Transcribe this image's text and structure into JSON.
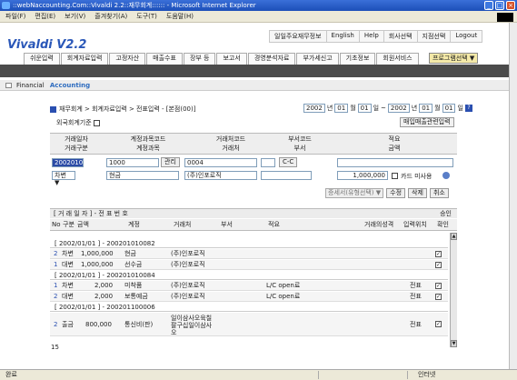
{
  "window": {
    "title": "::webNaccounting.Com::Vivaldi 2.2::재무회계:::::: - Microsoft Internet Explorer",
    "min": "_",
    "max": "□",
    "close": "×"
  },
  "menu": [
    "파일(F)",
    "편집(E)",
    "보기(V)",
    "즐겨찾기(A)",
    "도구(T)",
    "도움말(H)"
  ],
  "header": {
    "logo": "Vivaldi  V2.2",
    "top_links": [
      "일일주요재무정보",
      "English",
      "Help",
      "회사선택",
      "지점선택",
      "Logout"
    ],
    "nav": [
      "쉬운입력",
      "회계자료입력",
      "고정자산",
      "매출수표",
      "장부 등",
      "보고서",
      "경영분석자료",
      "부가세신고",
      "기초정보",
      "회원서비스"
    ],
    "program_select": "프로그램선택"
  },
  "section": {
    "financial": "Financial",
    "accounting": "Accounting"
  },
  "breadcrumb": "재무회계 > 회계자료입력 > 전표입력 - [본점(00)]",
  "date_range": {
    "from_year": "2002",
    "from_month": "01",
    "from_day": "01",
    "to_year": "2002",
    "to_month": "01",
    "to_day": "01",
    "year_label": "년",
    "month_label": "월",
    "day_label": "일",
    "tilde": "~",
    "help": "?"
  },
  "foreign_label": "외국회계기준",
  "related_button": "매입매출관련입력",
  "entry_headers": {
    "col1a": "거래일자",
    "col1b": "거래구분",
    "col2a": "계정과목코드",
    "col2b": "계정과목",
    "col3a": "거래처코드",
    "col3b": "거래처",
    "col4a": "부서코드",
    "col4b": "부서",
    "col5a": "적요",
    "col5b": "금액"
  },
  "entry": {
    "date": "20020101",
    "account_code": "1000",
    "lookup": "관리",
    "client_code": "0004",
    "dept_button": "C-C",
    "type": "차변",
    "account": "현금",
    "client": "(주)인포로직",
    "amount": "1,000,000",
    "card_label": "카드 미사용"
  },
  "actions": {
    "select": "증세서(유형선택)",
    "edit": "수정",
    "delete": "삭제",
    "cancel": "취소"
  },
  "list": {
    "title": "[ 거 래 일 자 ] - 전  표  번  호",
    "approve": "승인",
    "headers": [
      "No",
      "구분",
      "금액",
      "계정",
      "거래처",
      "부서",
      "적요",
      "거래의성격",
      "입력위치",
      "확인"
    ],
    "groups": [
      {
        "label": "[ 2002/01/01 ] - 200201010082",
        "rows": [
          {
            "no": "2",
            "type": "차변",
            "amount": "1,000,000",
            "account": "현금",
            "client": "(주)인포로직",
            "dept": "",
            "memo": "",
            "nature": "",
            "pos": "",
            "check": "✓"
          },
          {
            "no": "1",
            "type": "대변",
            "amount": "1,000,000",
            "account": "선수금",
            "client": "(주)인포로직",
            "dept": "",
            "memo": "",
            "nature": "",
            "pos": "",
            "check": "✓"
          }
        ]
      },
      {
        "label": "[ 2002/01/01 ] - 200201010084",
        "rows": [
          {
            "no": "1",
            "type": "차변",
            "amount": "2,000",
            "account": "미착품",
            "client": "(주)인포로직",
            "dept": "",
            "memo": "L/C open료",
            "nature": "",
            "pos": "전표",
            "check": "✓"
          },
          {
            "no": "2",
            "type": "대변",
            "amount": "2,000",
            "account": "보통예금",
            "client": "(주)인포로직",
            "dept": "",
            "memo": "L/C open료",
            "nature": "",
            "pos": "전표",
            "check": "✓"
          }
        ]
      },
      {
        "label": "[ 2002/01/01 ] - 200201100006",
        "rows": [
          {
            "no": "2",
            "type": "출금",
            "amount": "800,000",
            "account": "통신비(판)",
            "client": "일이삼사오육칠팔구십일이삼사오",
            "dept": "",
            "memo": "",
            "nature": "",
            "pos": "전표",
            "check": "✓"
          }
        ]
      }
    ],
    "count": "15"
  },
  "status": {
    "left": "완료",
    "right": "인터넷"
  }
}
